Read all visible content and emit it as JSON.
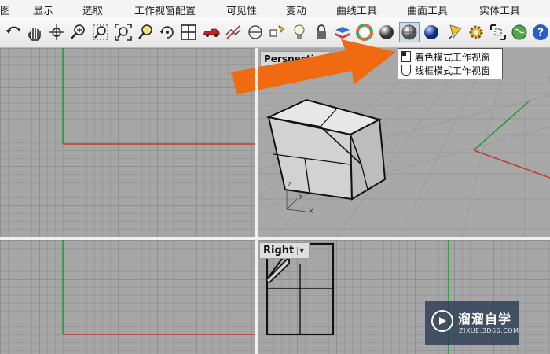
{
  "menu": {
    "items": [
      "图",
      "显示",
      "选取",
      "工作视窗配置",
      "可见性",
      "变动",
      "曲线工具",
      "曲面工具",
      "实体工具"
    ]
  },
  "toolbar": {
    "icons": [
      "undo-view-icon",
      "pan-hand-icon",
      "rotate-view-icon",
      "zoom-dynamic-icon",
      "zoom-window-icon",
      "zoom-extents-icon",
      "zoom-selected-icon",
      "rotate-camera-icon",
      "four-viewports-icon",
      "car-icon",
      "hide-object-icon",
      "lock-view-icon",
      "spotlight-icon",
      "bulb-icon",
      "padlock-icon",
      "layer-color-icon",
      "color-wheel-icon",
      "render-sphere-icon",
      "shaded-viewport-icon",
      "blue-sphere-icon",
      "spot-light-icon",
      "gear-icon",
      "group-select-icon",
      "globe-icon",
      "help-icon"
    ],
    "pressed": "shaded-viewport-icon"
  },
  "viewports": {
    "perspective": "Perspective",
    "right": "Right",
    "axis_labels": {
      "z": "z",
      "y": "y",
      "x": "x"
    }
  },
  "tooltip": {
    "line1": "着色模式工作视窗",
    "line2": "线框模式工作视窗"
  },
  "watermark": {
    "title": "溜溜自学",
    "subtitle": "ZIXUE.3D66.COM"
  },
  "colors": {
    "x_axis": "#c0392b",
    "y_axis": "#1e9a2c",
    "arrow": "#f06a12",
    "viewport_bg": "#a6a6a6"
  }
}
